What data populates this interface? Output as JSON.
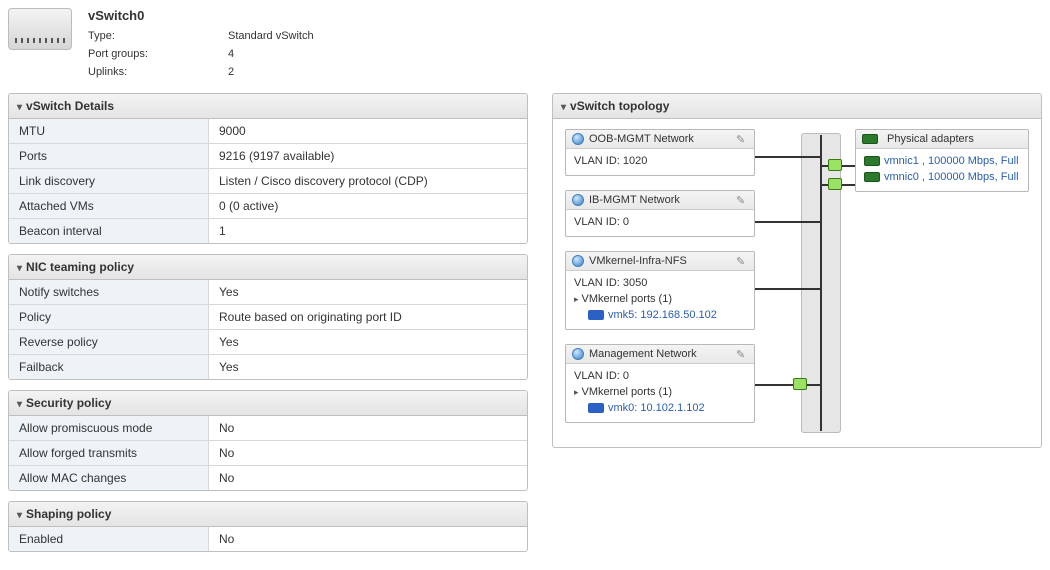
{
  "header": {
    "title": "vSwitch0",
    "type_label": "Type:",
    "type_value": "Standard vSwitch",
    "portgroups_label": "Port groups:",
    "portgroups_value": "4",
    "uplinks_label": "Uplinks:",
    "uplinks_value": "2"
  },
  "details": {
    "title": "vSwitch Details",
    "rows": {
      "mtu_k": "MTU",
      "mtu_v": "9000",
      "ports_k": "Ports",
      "ports_v": "9216 (9197 available)",
      "ld_k": "Link discovery",
      "ld_v": "Listen / Cisco discovery protocol (CDP)",
      "vm_k": "Attached VMs",
      "vm_v": "0 (0 active)",
      "bi_k": "Beacon interval",
      "bi_v": "1"
    }
  },
  "teaming": {
    "title": "NIC teaming policy",
    "rows": {
      "ns_k": "Notify switches",
      "ns_v": "Yes",
      "po_k": "Policy",
      "po_v": "Route based on originating port ID",
      "rp_k": "Reverse policy",
      "rp_v": "Yes",
      "fb_k": "Failback",
      "fb_v": "Yes"
    }
  },
  "security": {
    "title": "Security policy",
    "rows": {
      "pm_k": "Allow promiscuous mode",
      "pm_v": "No",
      "ft_k": "Allow forged transmits",
      "ft_v": "No",
      "mc_k": "Allow MAC changes",
      "mc_v": "No"
    }
  },
  "shaping": {
    "title": "Shaping policy",
    "rows": {
      "en_k": "Enabled",
      "en_v": "No"
    }
  },
  "topology": {
    "title": "vSwitch topology",
    "pg1": {
      "name": "OOB-MGMT Network",
      "vlan": "VLAN ID: 1020"
    },
    "pg2": {
      "name": "IB-MGMT Network",
      "vlan": "VLAN ID: 0"
    },
    "pg3": {
      "name": "VMkernel-Infra-NFS",
      "vlan": "VLAN ID: 3050",
      "ports_label": "VMkernel ports (1)",
      "port": "vmk5: 192.168.50.102"
    },
    "pg4": {
      "name": "Management Network",
      "vlan": "VLAN ID: 0",
      "ports_label": "VMkernel ports (1)",
      "port": "vmk0: 10.102.1.102"
    },
    "adapters": {
      "title": "Physical adapters",
      "a1": "vmnic1 , 100000 Mbps, Full",
      "a2": "vmnic0 , 100000 Mbps, Full"
    }
  }
}
